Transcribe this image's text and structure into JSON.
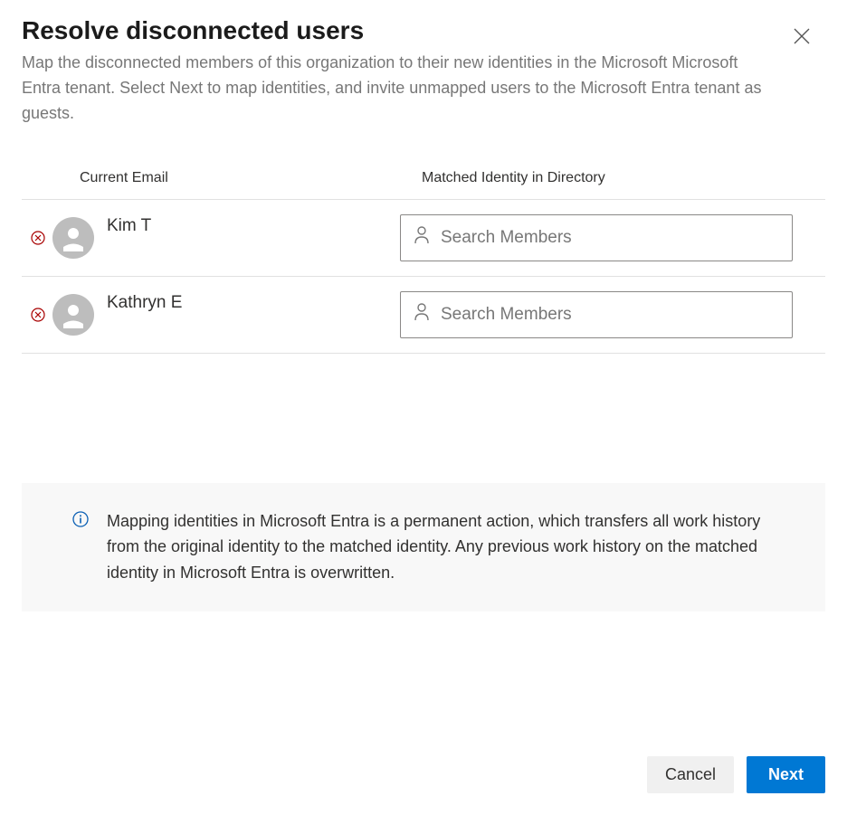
{
  "header": {
    "title": "Resolve disconnected users",
    "subtitle": "Map the disconnected members of this organization to their new identities in the Microsoft Microsoft Entra tenant. Select Next to map identities, and invite unmapped users to the Microsoft Entra tenant as guests."
  },
  "table": {
    "columns": {
      "email": "Current Email",
      "matched": "Matched Identity in Directory"
    },
    "search_placeholder": "Search Members",
    "users": [
      {
        "name": "Kim T"
      },
      {
        "name": "Kathryn E"
      }
    ]
  },
  "info": {
    "text": "Mapping identities in Microsoft Entra is a permanent action, which transfers all work history from the original identity to the matched identity. Any previous work history on the matched identity in Microsoft Entra is overwritten."
  },
  "footer": {
    "cancel": "Cancel",
    "next": "Next"
  }
}
